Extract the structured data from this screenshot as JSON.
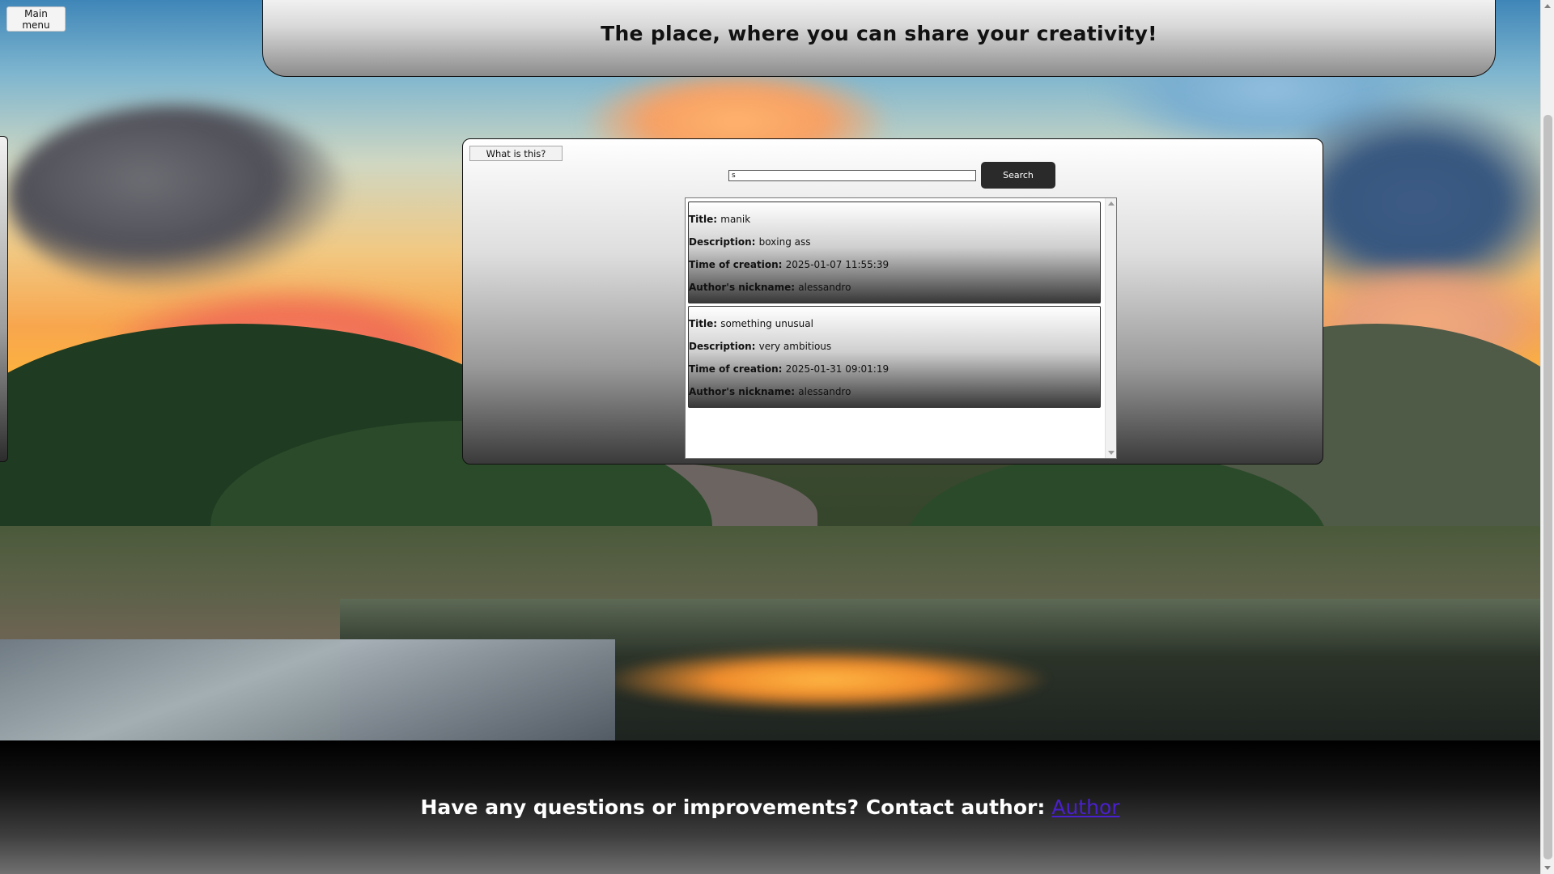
{
  "header": {
    "main_menu_label": "Main menu",
    "title": "The place, where you can share your creativity!"
  },
  "panel": {
    "help_button_label": "What is this?",
    "search": {
      "value": "s",
      "button_label": "Search"
    },
    "results": [
      {
        "title_label": "Title:",
        "title": "manik",
        "description_label": "Description:",
        "description": "boxing ass",
        "time_label": "Time of creation:",
        "time": "2025-01-07 11:55:39",
        "author_label": "Author's nickname:",
        "author": "alessandro"
      },
      {
        "title_label": "Title:",
        "title": "something unusual",
        "description_label": "Description:",
        "description": "very ambitious",
        "time_label": "Time of creation:",
        "time": "2025-01-31 09:01:19",
        "author_label": "Author's nickname:",
        "author": "alessandro"
      }
    ]
  },
  "footer": {
    "text": "Have any questions or improvements? Contact author:",
    "link_label": "Author"
  },
  "colors": {
    "search_button_bg": "#2a2a2a",
    "footer_link": "#4a1fcf"
  }
}
